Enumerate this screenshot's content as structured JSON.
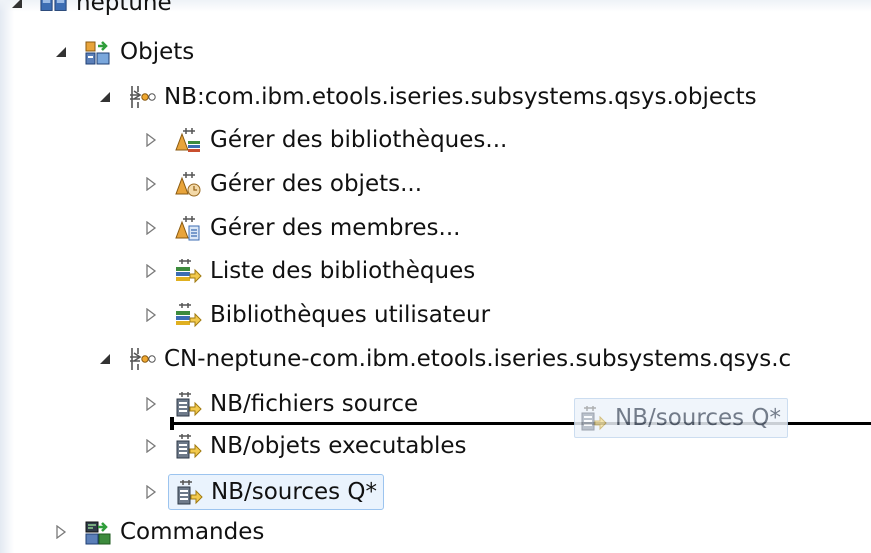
{
  "tree": {
    "root": {
      "label": "neptune",
      "icon": "system-connection-icon",
      "expanded": true
    },
    "objects": {
      "label": "Objets",
      "icon": "objects-subsystem-icon",
      "expanded": true
    },
    "filter_pool_nb": {
      "label": "NB:com.ibm.etools.iseries.subsystems.qsys.objects",
      "icon": "filter-pool-icon",
      "expanded": true,
      "children": [
        {
          "label": "Gérer des bibliothèques...",
          "icon": "manage-libraries-icon"
        },
        {
          "label": "Gérer des objets...",
          "icon": "manage-objects-icon"
        },
        {
          "label": "Gérer des membres...",
          "icon": "manage-members-icon"
        },
        {
          "label": "Liste des bibliothèques",
          "icon": "library-list-filter-icon"
        },
        {
          "label": "Bibliothèques utilisateur",
          "icon": "user-libraries-filter-icon"
        }
      ]
    },
    "filter_pool_cn": {
      "label": "CN-neptune-com.ibm.etools.iseries.subsystems.qsys.c",
      "icon": "filter-pool-icon",
      "expanded": true,
      "children": [
        {
          "label": "NB/fichiers source",
          "icon": "source-filter-icon"
        },
        {
          "label": "NB/objets executables",
          "icon": "object-filter-icon"
        },
        {
          "label": "NB/sources Q*",
          "icon": "source-filter-icon",
          "selected": true
        }
      ]
    },
    "commands": {
      "label": "Commandes",
      "icon": "commands-subsystem-icon",
      "expanded": false
    }
  },
  "drag": {
    "label": "NB/sources Q*",
    "icon": "source-filter-icon"
  },
  "colors": {
    "selection_bg": "#eaf3fd",
    "selection_border": "#9cc4ef",
    "drop_indicator": "#000000",
    "twisty": "#7a7a7a"
  }
}
